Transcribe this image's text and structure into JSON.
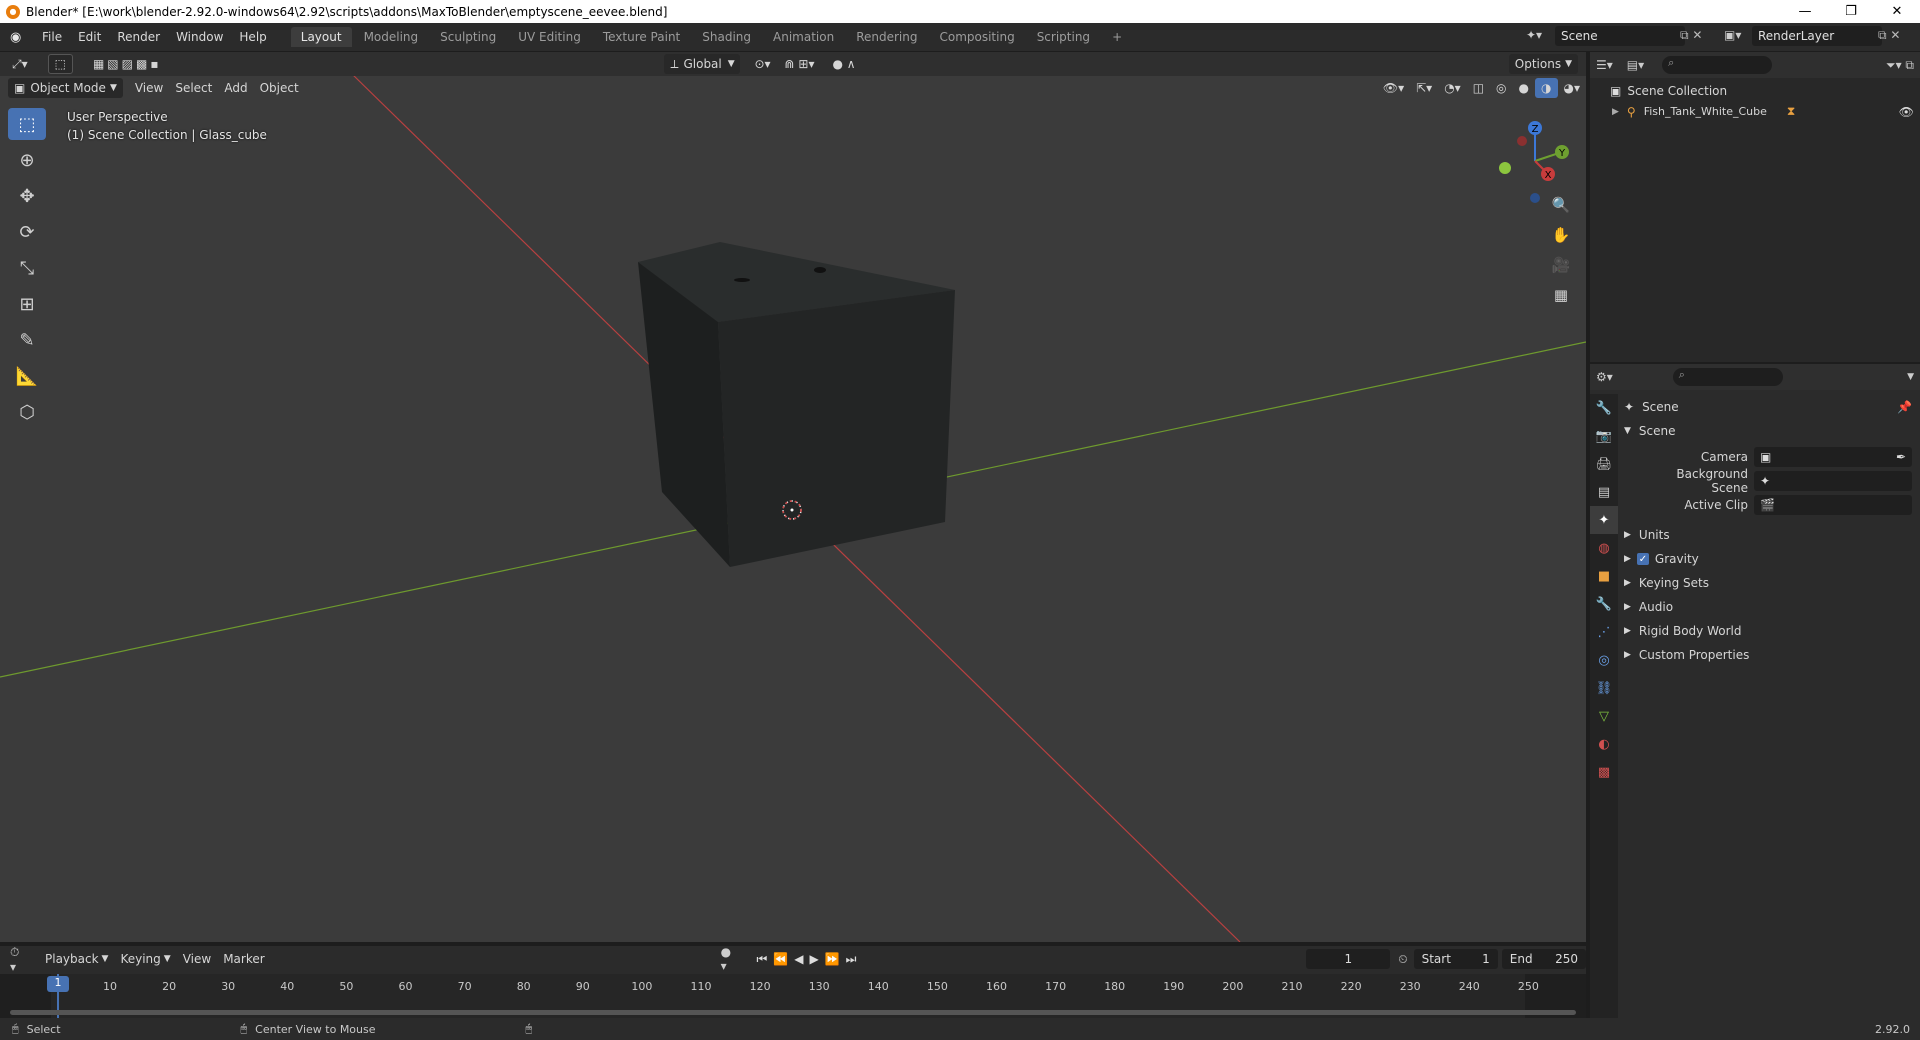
{
  "window": {
    "title": "Blender* [E:\\work\\blender-2.92.0-windows64\\2.92\\scripts\\addons\\MaxToBlender\\emptyscene_eevee.blend]",
    "minimize": "—",
    "maximize": "❐",
    "close": "✕"
  },
  "menu": {
    "items": [
      "File",
      "Edit",
      "Render",
      "Window",
      "Help"
    ]
  },
  "workspaces": [
    "Layout",
    "Modeling",
    "Sculpting",
    "UV Editing",
    "Texture Paint",
    "Shading",
    "Animation",
    "Rendering",
    "Compositing",
    "Scripting"
  ],
  "workspace_add": "+",
  "scene_selector": "Scene",
  "view_layer_selector": "RenderLayer",
  "viewport": {
    "transform_orientation": "Global",
    "options_label": "Options",
    "mode": "Object Mode",
    "menus": [
      "View",
      "Select",
      "Add",
      "Object"
    ],
    "overlay_text_1": "User Perspective",
    "overlay_text_2": "(1) Scene Collection | Glass_cube",
    "gizmo_axes": {
      "x": "X",
      "y": "Y",
      "z": "Z"
    }
  },
  "outliner": {
    "root": "Scene Collection",
    "items": [
      {
        "label": "Fish_Tank_White_Cube"
      }
    ]
  },
  "properties": {
    "context_label": "Scene",
    "panel_title": "Scene",
    "fields": [
      {
        "label": "Camera",
        "value": ""
      },
      {
        "label": "Background Scene",
        "value": ""
      },
      {
        "label": "Active Clip",
        "value": ""
      }
    ],
    "subpanels": [
      {
        "label": "Units",
        "checkbox": false
      },
      {
        "label": "Gravity",
        "checkbox": true
      },
      {
        "label": "Keying Sets",
        "checkbox": false
      },
      {
        "label": "Audio",
        "checkbox": false
      },
      {
        "label": "Rigid Body World",
        "checkbox": false
      },
      {
        "label": "Custom Properties",
        "checkbox": false
      }
    ]
  },
  "timeline": {
    "menus": [
      "Playback",
      "Keying",
      "View",
      "Marker"
    ],
    "current_frame": "1",
    "start_label": "Start",
    "start_value": "1",
    "end_label": "End",
    "end_value": "250",
    "frame_marker": "1",
    "ruler": [
      "10",
      "20",
      "30",
      "40",
      "50",
      "60",
      "70",
      "80",
      "90",
      "100",
      "110",
      "120",
      "130",
      "140",
      "150",
      "160",
      "170",
      "180",
      "190",
      "200",
      "210",
      "220",
      "230",
      "240",
      "250"
    ]
  },
  "status": {
    "select": "Select",
    "center_view": "Center View to Mouse",
    "version": "2.92.0"
  },
  "colors": {
    "accent": "#4772b3",
    "x_axis": "#c83c3c",
    "y_axis": "#6ea030",
    "z_axis": "#3c78d8",
    "active_tab": "#3d3d3d"
  }
}
